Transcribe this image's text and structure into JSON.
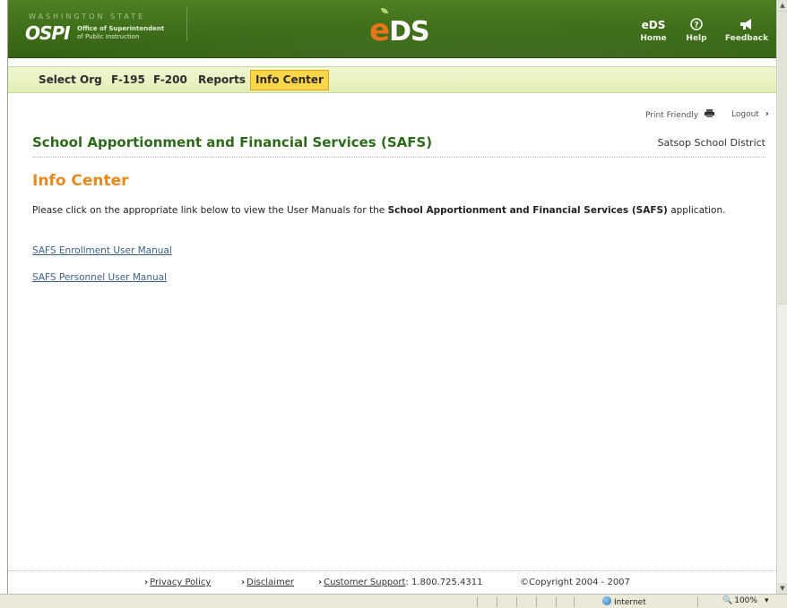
{
  "header": {
    "state_text": "WASHINGTON STATE",
    "ospi_text": "OSPI",
    "ospi_sub_line1": "Office of Superintendent",
    "ospi_sub_line2": "of Public Instruction",
    "eds_e": "e",
    "eds_rest": "DS",
    "buttons": [
      {
        "glyph": "eDS",
        "label": "Home",
        "icon": "home-eds-icon"
      },
      {
        "glyph": "?",
        "label": "Help",
        "icon": "help-icon"
      },
      {
        "glyph": "◀",
        "label": "Feedback",
        "icon": "megaphone-icon"
      }
    ]
  },
  "nav": {
    "items": [
      {
        "label": "Select Org",
        "active": false
      },
      {
        "label": "F-195",
        "active": false
      },
      {
        "label": "F-200",
        "active": false
      },
      {
        "label": "Reports",
        "active": false
      },
      {
        "label": "Info Center",
        "active": true
      }
    ]
  },
  "utilities": {
    "print_label": "Print Friendly",
    "logout_label": "Logout"
  },
  "page": {
    "title": "School Apportionment and Financial Services (SAFS)",
    "district": "Satsop School District",
    "section_title": "Info Center",
    "intro_prefix": "Please click on the appropriate link below to view the User Manuals for the ",
    "intro_bold": "School Apportionment and Financial Services (SAFS)",
    "intro_suffix": " application.",
    "links": [
      "SAFS Enrollment User Manual",
      "SAFS Personnel User Manual"
    ]
  },
  "footer": {
    "privacy": "Privacy Policy",
    "disclaimer": "Disclaimer",
    "support_link": "Customer Support",
    "support_phone": ": 1.800.725.4311",
    "copyright": "©Copyright 2004 - 2007"
  },
  "statusbar": {
    "zone": "Internet",
    "zoom": "100%"
  },
  "colors": {
    "header_green": "#3d6c18",
    "title_green": "#2d6a1b",
    "section_orange": "#e48a1f",
    "active_tab": "#ffd54a",
    "link_blue": "#3b5f8a"
  }
}
